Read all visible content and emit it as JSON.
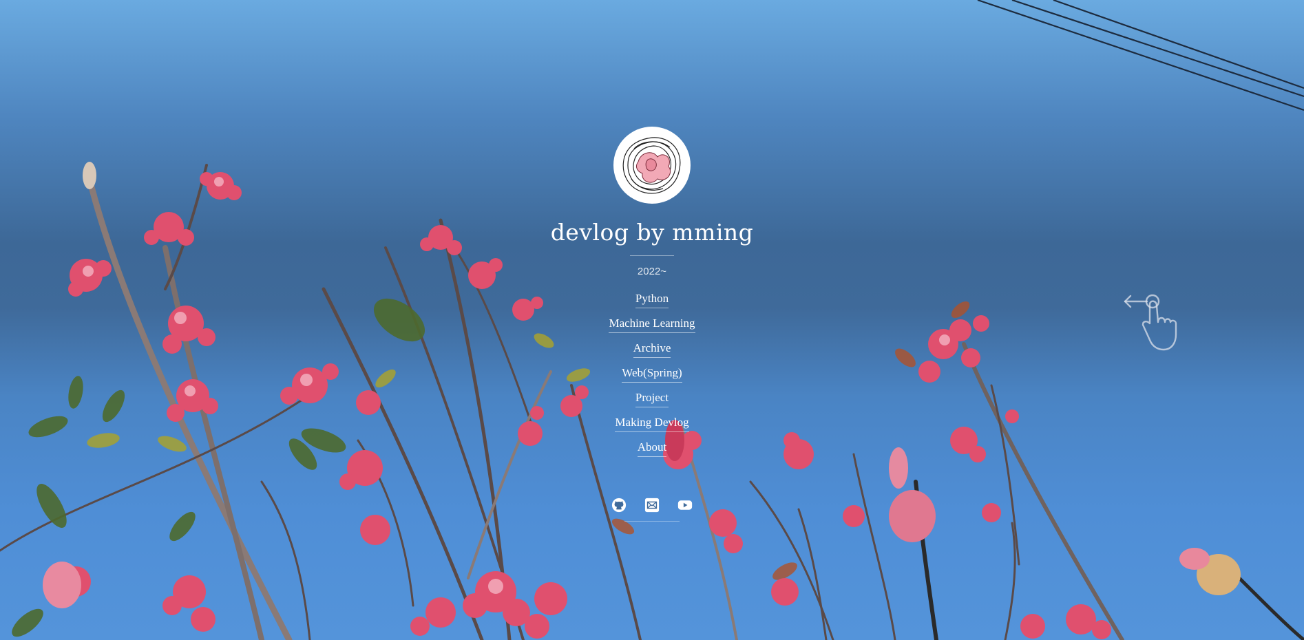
{
  "site": {
    "title": "devlog by mming",
    "subtitle": "2022~",
    "avatar_icon": "pink-flower-sketch-icon"
  },
  "nav": {
    "items": [
      {
        "label": "Python"
      },
      {
        "label": "Machine Learning"
      },
      {
        "label": "Archive"
      },
      {
        "label": "Web(Spring)"
      },
      {
        "label": "Project"
      },
      {
        "label": "Making Devlog"
      },
      {
        "label": "About"
      }
    ]
  },
  "social": {
    "icons": [
      "github-icon",
      "mail-icon",
      "youtube-icon"
    ]
  },
  "hint": {
    "icon": "swipe-left-hand-icon"
  },
  "colors": {
    "text": "#ffffff",
    "sky_top": "#6aaae0",
    "sky_mid": "#3d6897",
    "blossom": "#e0506e"
  }
}
